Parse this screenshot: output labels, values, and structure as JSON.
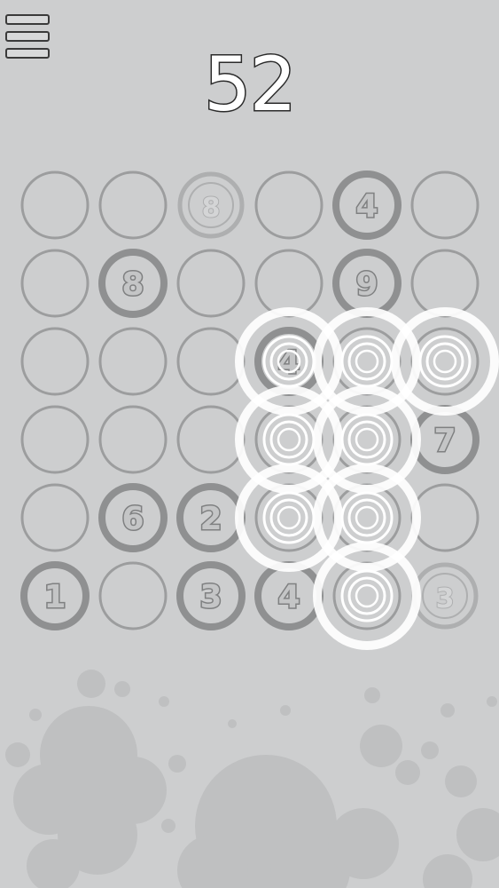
{
  "app": {
    "score": "52"
  },
  "colors": {
    "background": "#cdcecf",
    "empty_ring": "#9c9d9e",
    "number_ring": "#8f9091",
    "number_fill": "#c4c5c6",
    "faded_number": "#aeafb0",
    "highlight": "#ffffff",
    "splatter": "#bfc0c1"
  },
  "board": {
    "rows": 6,
    "cols": 6,
    "cells": [
      [
        {
          "value": ""
        },
        {
          "value": ""
        },
        {
          "value": "8",
          "faded": true
        },
        {
          "value": ""
        },
        {
          "value": "4"
        },
        {
          "value": ""
        }
      ],
      [
        {
          "value": ""
        },
        {
          "value": "8"
        },
        {
          "value": ""
        },
        {
          "value": ""
        },
        {
          "value": "9"
        },
        {
          "value": ""
        }
      ],
      [
        {
          "value": ""
        },
        {
          "value": ""
        },
        {
          "value": ""
        },
        {
          "value": "4",
          "selected": true
        },
        {
          "value": "",
          "selected": true
        },
        {
          "value": "",
          "selected": true
        }
      ],
      [
        {
          "value": ""
        },
        {
          "value": ""
        },
        {
          "value": ""
        },
        {
          "value": "",
          "selected": true
        },
        {
          "value": "",
          "selected": true
        },
        {
          "value": "7"
        }
      ],
      [
        {
          "value": ""
        },
        {
          "value": "6"
        },
        {
          "value": "2"
        },
        {
          "value": "",
          "selected": true
        },
        {
          "value": "",
          "selected": true
        },
        {
          "value": ""
        }
      ],
      [
        {
          "value": "1"
        },
        {
          "value": ""
        },
        {
          "value": "3"
        },
        {
          "value": "4"
        },
        {
          "value": "",
          "selected": true
        },
        {
          "value": "3",
          "faded": true
        }
      ]
    ]
  }
}
